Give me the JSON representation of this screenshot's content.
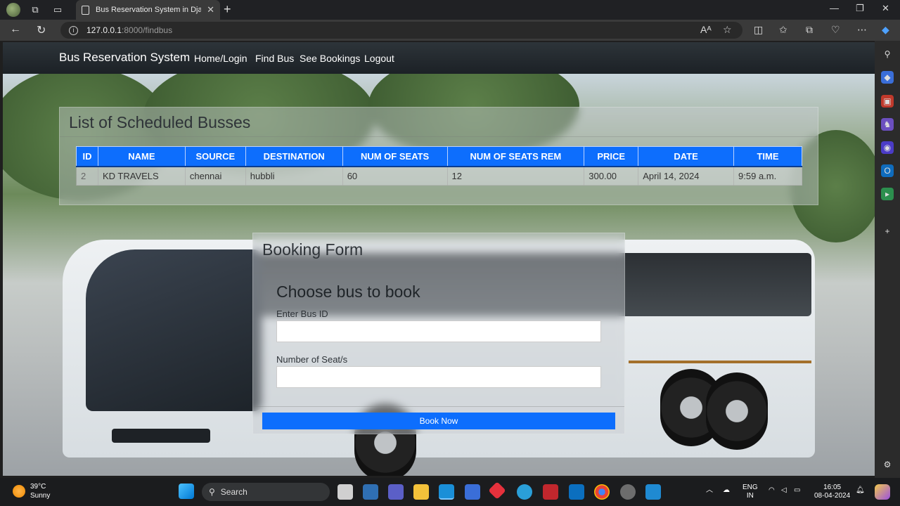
{
  "browser": {
    "tab_title": "Bus Reservation System in Djang",
    "tab_close": "✕",
    "new_tab": "+",
    "url_host": "127.0.0.1",
    "url_path": ":8000/findbus"
  },
  "app": {
    "brand": "Bus Reservation System",
    "nav": [
      "Home/Login",
      "Find Bus",
      "See Bookings",
      "Logout"
    ]
  },
  "schedule": {
    "title": "List of Scheduled Busses",
    "columns": [
      "ID",
      "NAME",
      "SOURCE",
      "DESTINATION",
      "NUM OF SEATS",
      "NUM OF SEATS REM",
      "PRICE",
      "DATE",
      "TIME"
    ],
    "rows": [
      [
        "2",
        "KD TRAVELS",
        "chennai",
        "hubbli",
        "60",
        "12",
        "300.00",
        "April 14, 2024",
        "9:59 a.m."
      ]
    ]
  },
  "booking": {
    "title": "Booking Form",
    "subtitle": "Choose bus to book",
    "bus_id_label": "Enter Bus ID",
    "bus_id_value": "",
    "seats_label": "Number of Seat/s",
    "seats_value": "",
    "submit": "Book Now"
  },
  "taskbar": {
    "temperature": "39°C",
    "condition": "Sunny",
    "search": "Search",
    "lang_top": "ENG",
    "lang_bottom": "IN",
    "time": "16:05",
    "date": "08-04-2024"
  },
  "colors": {
    "primary": "#0d6efd",
    "navbar": "#212529",
    "accent_panel": "rgba(200,205,208,0.45)"
  }
}
